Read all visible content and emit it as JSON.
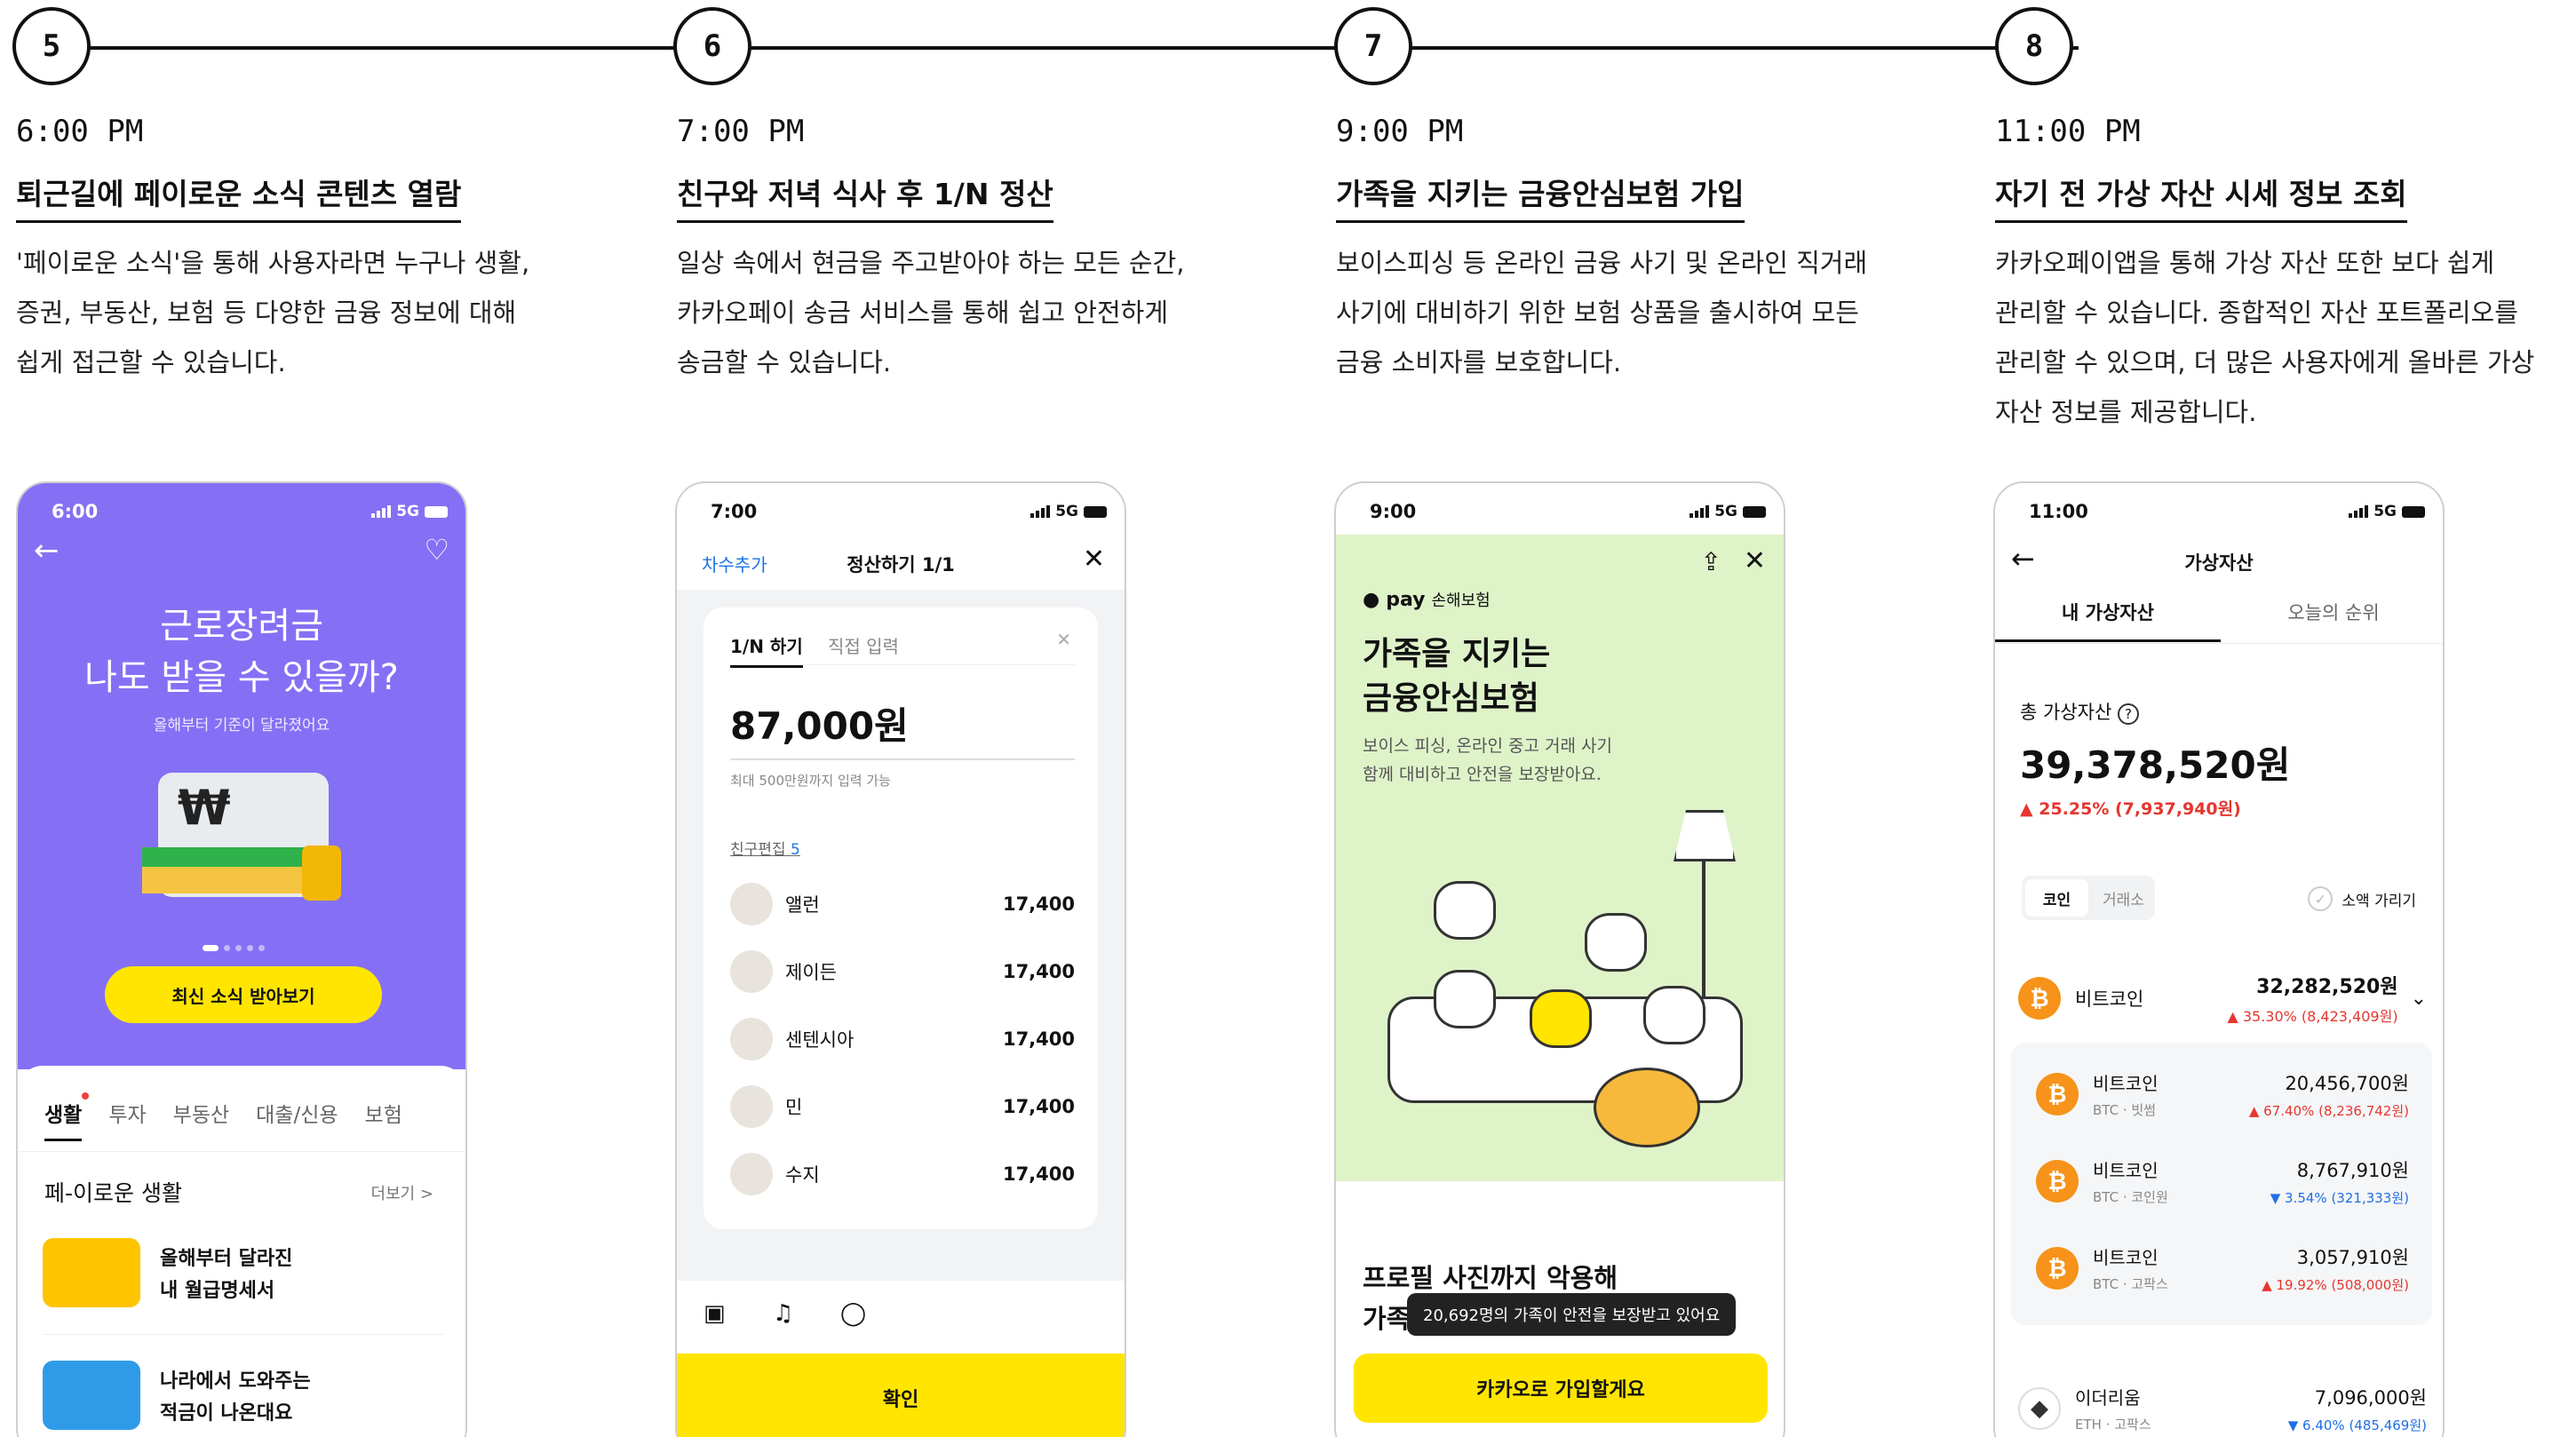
{
  "timeline": {
    "steps": [
      "5",
      "6",
      "7",
      "8"
    ]
  },
  "columns": [
    {
      "time": "6:00 PM",
      "headline": "퇴근길에 페이로운 소식 콘텐츠 열람",
      "desc": [
        "'페이로운 소식'을 통해 사용자라면 누구나 생활,",
        "증권, 부동산, 보험 등 다양한 금융 정보에 대해",
        "쉽게 접근할 수 있습니다."
      ]
    },
    {
      "time": "7:00 PM",
      "headline": "친구와 저녁 식사 후 1/N 정산",
      "desc": [
        "일상 속에서 현금을 주고받아야 하는 모든 순간,",
        "카카오페이 송금 서비스를 통해 쉽고 안전하게",
        "송금할 수 있습니다."
      ]
    },
    {
      "time": "9:00 PM",
      "headline": "가족을 지키는 금융안심보험 가입",
      "desc": [
        "보이스피싱 등 온라인 금융 사기 및 온라인 직거래",
        "사기에 대비하기 위한 보험 상품을 출시하여 모든",
        "금융 소비자를 보호합니다."
      ]
    },
    {
      "time": "11:00 PM",
      "headline": "자기 전 가상 자산 시세 정보 조회",
      "desc": [
        "카카오페이앱을 통해 가상 자산 또한 보다 쉽게",
        "관리할 수 있습니다. 종합적인 자산 포트폴리오를",
        "관리할 수 있으며, 더 많은 사용자에게 올바른 가상",
        "자산 정보를 제공합니다."
      ]
    }
  ],
  "phone5": {
    "status_time": "6:00",
    "network": "5G",
    "title_line1": "근로장려금",
    "title_line2": "나도 받을 수 있을까?",
    "subtitle": "올해부터 기준이 달라졌어요",
    "cta": "최신 소식 받아보기",
    "tabs": [
      "생활",
      "투자",
      "부동산",
      "대출/신용",
      "보험"
    ],
    "section_title": "페-이로운 생활",
    "more": "더보기 >",
    "items": [
      {
        "line1": "올해부터 달라진",
        "line2": "내 월급명세서"
      },
      {
        "line1": "나라에서 도와주는",
        "line2": "적금이 나온대요"
      }
    ]
  },
  "phone6": {
    "status_time": "7:00",
    "network": "5G",
    "left_action": "차수추가",
    "title": "정산하기 1/1",
    "tab_active": "1/N 하기",
    "tab_inactive": "직접 입력",
    "amount": "87,000원",
    "hint": "최대 500만원까지 입력 가능",
    "friends_label": "친구편집",
    "friends_count": "5",
    "rows": [
      {
        "name": "앨런",
        "amount": "17,400"
      },
      {
        "name": "제이든",
        "amount": "17,400"
      },
      {
        "name": "센텐시아",
        "amount": "17,400"
      },
      {
        "name": "민",
        "amount": "17,400"
      },
      {
        "name": "수지",
        "amount": "17,400"
      }
    ],
    "confirm": "확인"
  },
  "phone7": {
    "status_time": "9:00",
    "network": "5G",
    "brand_pay": "pay",
    "brand_sub": "손해보험",
    "title_line1": "가족을 지키는",
    "title_line2": "금융안심보험",
    "sub_line1": "보이스 피싱, 온라인 중고 거래 사기",
    "sub_line2": "함께 대비하고 안전을 보장받아요.",
    "bottom_line1": "프로필 사진까지 악용해",
    "bottom_line2_prefix": "가족",
    "tooltip": "20,692명의 가족이 안전을 보장받고 있어요",
    "cta": "카카오로 가입할게요"
  },
  "phone8": {
    "status_time": "11:00",
    "network": "5G",
    "title": "가상자산",
    "tab_active": "내 가상자산",
    "tab_inactive": "오늘의 순위",
    "total_label": "총 가상자산",
    "total": "39,378,520원",
    "total_change": "▲ 25.25%  (7,937,940원)",
    "seg_active": "코인",
    "seg_inactive": "거래소",
    "hide_small": "소액 가리기",
    "main_coin": {
      "name": "비트코인",
      "value": "32,282,520원",
      "change": "▲ 35.30% (8,423,409원)"
    },
    "sub_coins": [
      {
        "name": "비트코인",
        "sub": "BTC · 빗썸",
        "value": "20,456,700원",
        "change": "▲ 67.40% (8,236,742원)",
        "dir": "up"
      },
      {
        "name": "비트코인",
        "sub": "BTC · 코인원",
        "value": "8,767,910원",
        "change": "▼ 3.54% (321,333원)",
        "dir": "down"
      },
      {
        "name": "비트코인",
        "sub": "BTC · 고팍스",
        "value": "3,057,910원",
        "change": "▲ 19.92% (508,000원)",
        "dir": "up"
      }
    ],
    "eth": {
      "name": "이더리움",
      "sub": "ETH · 고팍스",
      "value": "7,096,000원",
      "change": "▼ 6.40% (485,469원)"
    }
  }
}
